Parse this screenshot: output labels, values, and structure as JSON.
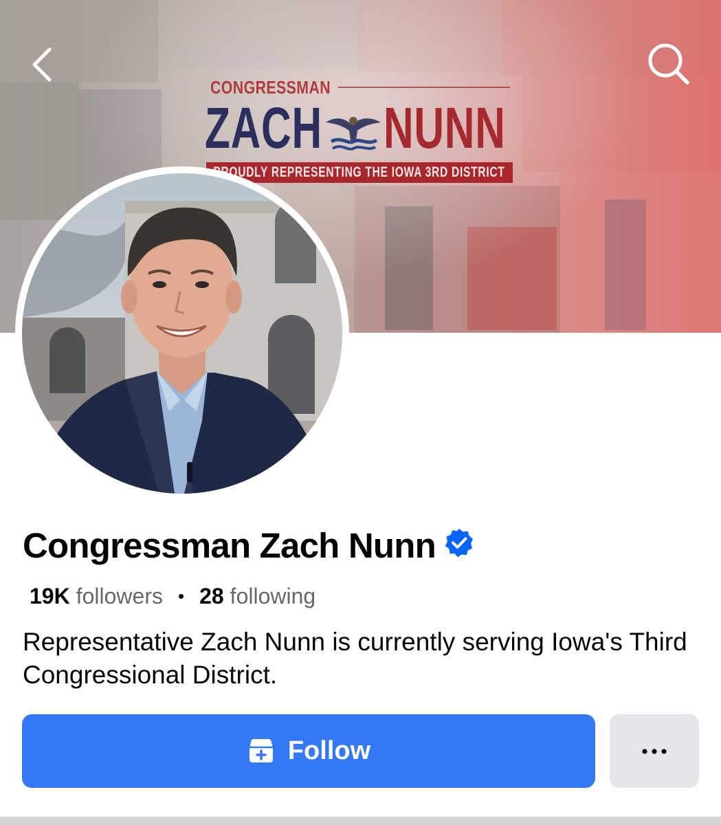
{
  "cover": {
    "logo_top_line": "CONGRESSMAN",
    "logo_first_name": "ZACH",
    "logo_last_name": "NUNN",
    "logo_banner_text": "PROUDLY REPRESENTING THE IOWA 3RD DISTRICT"
  },
  "nav": {
    "back_icon": "chevron-left-icon",
    "search_icon": "search-icon"
  },
  "profile": {
    "name": "Congressman Zach Nunn",
    "verified_icon": "verified-badge-icon",
    "followers_count": "19K",
    "followers_label": "followers",
    "separator": "•",
    "following_count": "28",
    "following_label": "following",
    "bio": "Representative Zach Nunn is currently serving Iowa's Third Congressional District."
  },
  "actions": {
    "follow_label": "Follow",
    "follow_icon": "follow-box-plus-icon",
    "more_label": "…",
    "more_icon": "more-dots-icon"
  },
  "colors": {
    "primary_blue": "#3478f6",
    "verified_blue": "#0866ff",
    "secondary_gray": "#e4e6eb",
    "muted_text": "#65676b"
  }
}
